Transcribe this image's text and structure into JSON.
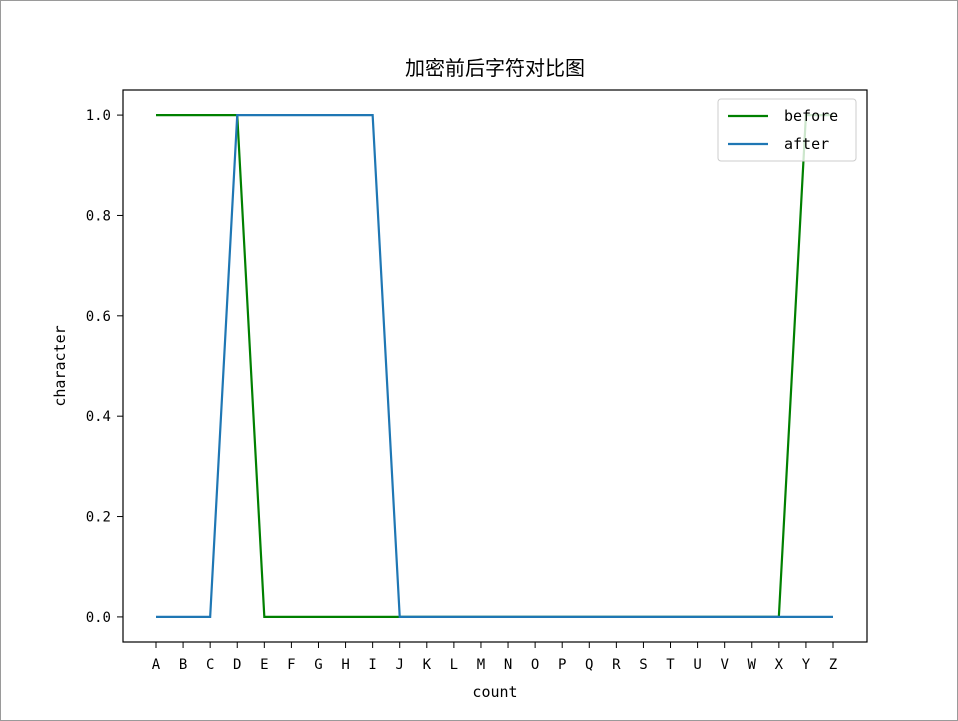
{
  "chart_data": {
    "type": "line",
    "title": "加密前后字符对比图",
    "xlabel": "count",
    "ylabel": "character",
    "categories": [
      "A",
      "B",
      "C",
      "D",
      "E",
      "F",
      "G",
      "H",
      "I",
      "J",
      "K",
      "L",
      "M",
      "N",
      "O",
      "P",
      "Q",
      "R",
      "S",
      "T",
      "U",
      "V",
      "W",
      "X",
      "Y",
      "Z"
    ],
    "ylim": [
      -0.05,
      1.05
    ],
    "yticks": [
      "0.0",
      "0.2",
      "0.4",
      "0.6",
      "0.8",
      "1.0"
    ],
    "ytick_values": [
      0,
      0.2,
      0.4,
      0.6,
      0.8,
      1.0
    ],
    "grid": false,
    "legend_position": "top-right",
    "series": [
      {
        "name": "before",
        "color": "#008000",
        "values": [
          1,
          1,
          1,
          1,
          0,
          0,
          0,
          0,
          0,
          0,
          0,
          0,
          0,
          0,
          0,
          0,
          0,
          0,
          0,
          0,
          0,
          0,
          0,
          0,
          1,
          1
        ]
      },
      {
        "name": "after",
        "color": "#1f77b4",
        "values": [
          0,
          0,
          0,
          1,
          1,
          1,
          1,
          1,
          1,
          0,
          0,
          0,
          0,
          0,
          0,
          0,
          0,
          0,
          0,
          0,
          0,
          0,
          0,
          0,
          0,
          0
        ]
      }
    ]
  }
}
